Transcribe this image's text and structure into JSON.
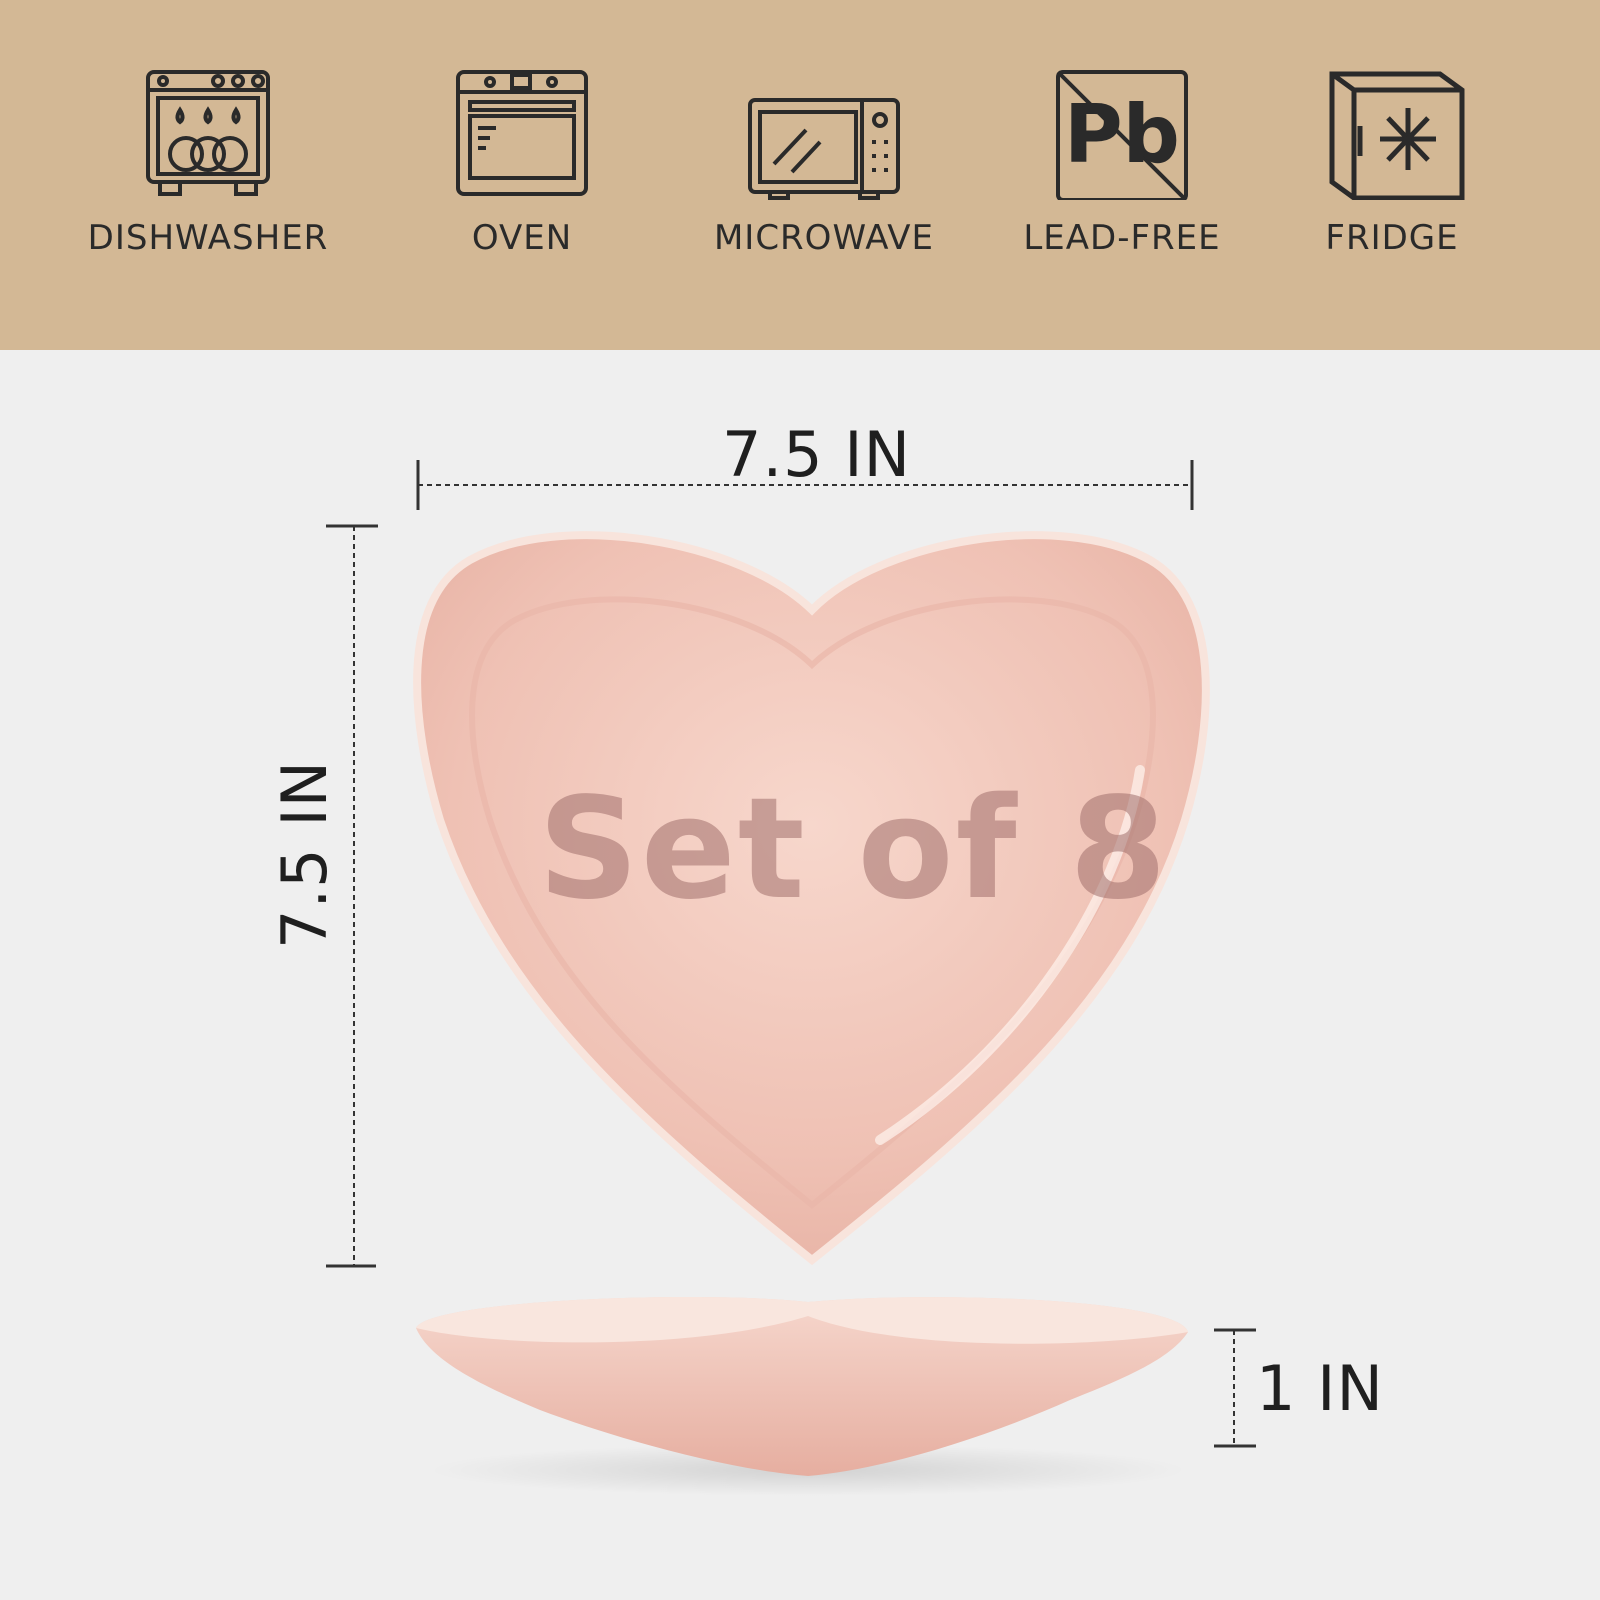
{
  "features": [
    {
      "icon": "dishwasher-icon",
      "label": "DISHWASHER"
    },
    {
      "icon": "oven-icon",
      "label": "OVEN"
    },
    {
      "icon": "microwave-icon",
      "label": "MICROWAVE"
    },
    {
      "icon": "lead-free-icon",
      "label": "LEAD-FREE",
      "icon_text": "Pb"
    },
    {
      "icon": "fridge-icon",
      "label": "FRIDGE"
    }
  ],
  "dimensions": {
    "width": "7.5 IN",
    "height": "7.5 IN",
    "depth": "1 IN"
  },
  "overlay_text": "Set of 8",
  "colors": {
    "banner": "#d3b895",
    "background": "#efefef",
    "plate": "#f2c9bd",
    "icon_stroke": "#2a2a2a"
  }
}
